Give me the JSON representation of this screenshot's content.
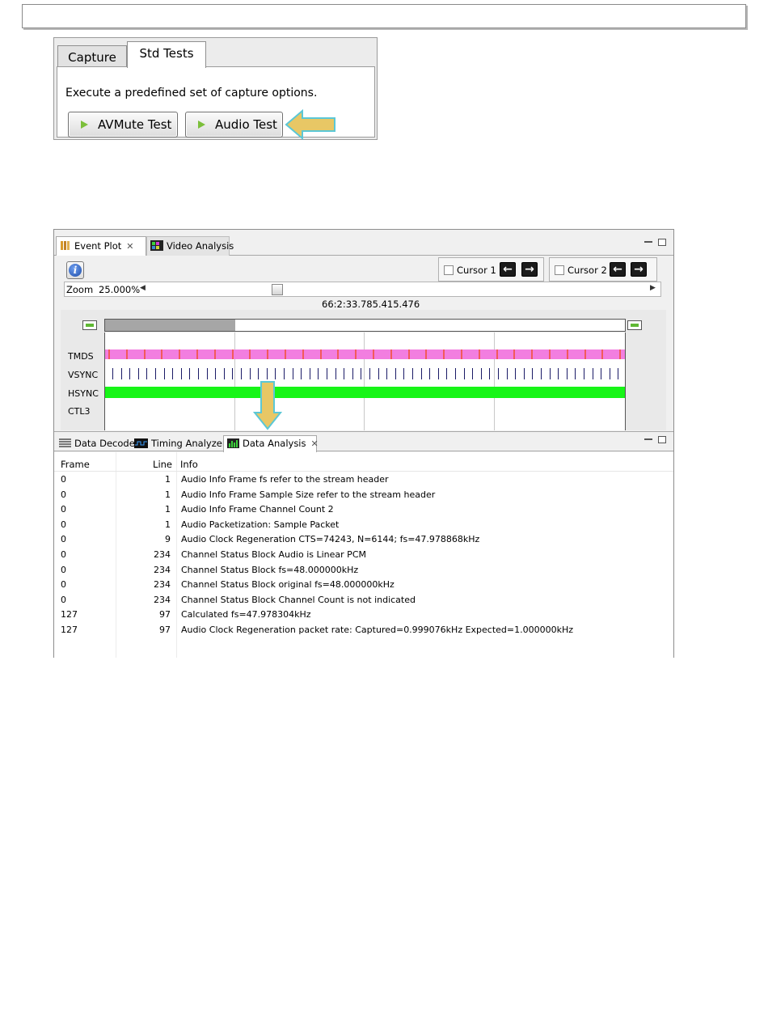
{
  "std_tests": {
    "tabs": [
      "Capture",
      "Std Tests"
    ],
    "description": "Execute a predefined set of capture options.",
    "buttons": {
      "avmute": "AVMute Test",
      "audio": "Audio Test"
    }
  },
  "main": {
    "tabs": [
      "Event Plot",
      "Video Analysis"
    ],
    "cursors": [
      "Cursor 1",
      "Cursor 2"
    ],
    "zoom_label": "Zoom",
    "zoom_value": "25.000%",
    "timestamp": "66:2:33.785.415.476",
    "signals": [
      "TMDS",
      "VSYNC",
      "HSYNC",
      "CTL3"
    ],
    "colors": {
      "tmds": "#f27ee0",
      "hsync": "#17f517",
      "callout_arrow": "#e8c765"
    }
  },
  "bottom": {
    "tabs": [
      "Data Decode",
      "Timing Analyzer",
      "Data Analysis"
    ],
    "columns": [
      "Frame",
      "Line",
      "Info"
    ],
    "rows": [
      [
        "0",
        "1",
        "Audio Info Frame fs refer to the stream header"
      ],
      [
        "0",
        "1",
        "Audio Info Frame Sample Size refer to the stream header"
      ],
      [
        "0",
        "1",
        "Audio Info Frame Channel Count 2"
      ],
      [
        "0",
        "1",
        "Audio  Packetization: Sample Packet"
      ],
      [
        "0",
        "9",
        "Audio Clock Regeneration CTS=74243, N=6144; fs=47.978868kHz"
      ],
      [
        "0",
        "234",
        "Channel Status Block Audio is Linear PCM"
      ],
      [
        "0",
        "234",
        "Channel Status Block fs=48.000000kHz"
      ],
      [
        "0",
        "234",
        "Channel Status Block original fs=48.000000kHz"
      ],
      [
        "0",
        "234",
        "Channel Status Block Channel Count is not indicated"
      ],
      [
        "127",
        "97",
        "Calculated fs=47.978304kHz"
      ],
      [
        "127",
        "97",
        "Audio Clock Regeneration packet rate: Captured=0.999076kHz  Expected=1.000000kHz"
      ]
    ]
  }
}
